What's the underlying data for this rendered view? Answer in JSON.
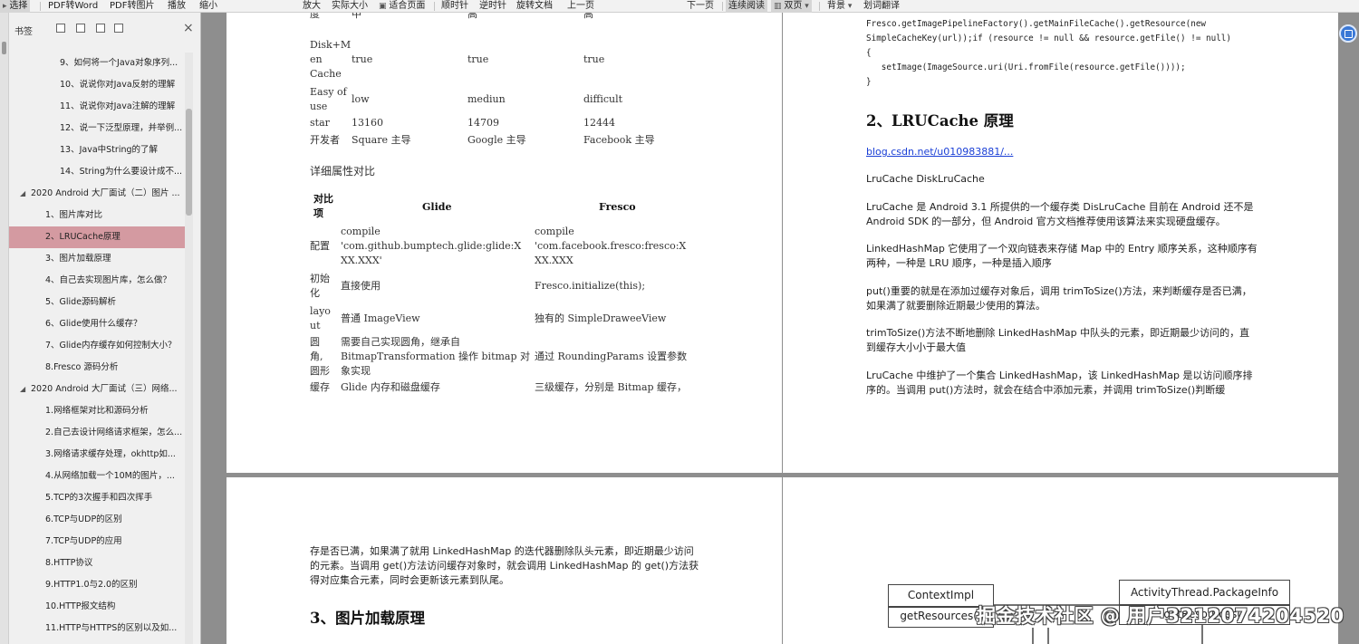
{
  "toolbar": {
    "select": "选择",
    "pdf_to_word": "PDF转Word",
    "pdf_to_image": "PDF转图片",
    "play": "播放",
    "zoom_out": "缩小",
    "zoom_in": "放大",
    "actual_size": "实际大小",
    "fit_page": "适合页面",
    "rotate_cw": "顺时针",
    "rotate_ccw": "逆时针",
    "rotate_doc": "旋转文档",
    "prev_page": "上一页",
    "next_page": "下一页",
    "continuous": "连续阅读",
    "two_page": "双页",
    "background": "背景",
    "translate": "划词翻译"
  },
  "sidebar": {
    "title": "书签",
    "bookmarks": [
      {
        "label": "9、如何将一个Java对象序列...",
        "level": 2
      },
      {
        "label": "10、说说你对Java反射的理解",
        "level": 2
      },
      {
        "label": "11、说说你对Java注解的理解",
        "level": 2
      },
      {
        "label": "12、说一下泛型原理，并举例...",
        "level": 2
      },
      {
        "label": "13、Java中String的了解",
        "level": 2
      },
      {
        "label": "14、String为什么要设计成不...",
        "level": 2
      },
      {
        "label": "2020 Android 大厂面试（二）图片 ...",
        "level": 1
      },
      {
        "label": "1、图片库对比",
        "level": 2
      },
      {
        "label": "2、LRUCache原理",
        "level": 2,
        "selected": true
      },
      {
        "label": "3、图片加载原理",
        "level": 2
      },
      {
        "label": "4、自己去实现图片库，怎么做？",
        "level": 2
      },
      {
        "label": "5、Glide源码解析",
        "level": 2
      },
      {
        "label": "6、Glide使用什么缓存？",
        "level": 2
      },
      {
        "label": "7、Glide内存缓存如何控制大小？",
        "level": 2
      },
      {
        "label": "8.Fresco 源码分析",
        "level": 2
      },
      {
        "label": "2020 Android 大厂面试（三）网络...",
        "level": 1
      },
      {
        "label": "1.网络框架对比和源码分析",
        "level": 2
      },
      {
        "label": "2.自己去设计网络请求框架，怎么...",
        "level": 2
      },
      {
        "label": "3.网络请求缓存处理，okhttp如...",
        "level": 2
      },
      {
        "label": "4.从网络加载一个10M的图片，...",
        "level": 2
      },
      {
        "label": "5.TCP的3次握手和四次挥手",
        "level": 2
      },
      {
        "label": "6.TCP与UDP的区别",
        "level": 2
      },
      {
        "label": "7.TCP与UDP的应用",
        "level": 2
      },
      {
        "label": "8.HTTP协议",
        "level": 2
      },
      {
        "label": "9.HTTP1.0与2.0的区别",
        "level": 2
      },
      {
        "label": "10.HTTP报文结构",
        "level": 2
      },
      {
        "label": "11.HTTP与HTTPS的区别以及如...",
        "level": 2
      }
    ]
  },
  "page1": {
    "top_table": {
      "r0": [
        "度",
        "中",
        "高",
        "高"
      ],
      "r1": [
        "Disk+M\nen\nCache",
        "true",
        "true",
        "true"
      ],
      "r2": [
        "Easy of\nuse",
        "low",
        "mediun",
        "difficult"
      ],
      "r3": [
        "star",
        "13160",
        "14709",
        "12444"
      ],
      "r4": [
        "开发者",
        "Square 主导",
        "Google 主导",
        "Facebook 主导"
      ]
    },
    "detail_caption": "详细属性对比",
    "detail_table": {
      "headers": [
        "对比\n项",
        "Glide",
        "Fresco"
      ],
      "rows": [
        [
          "配置",
          "compile\n'com.github.bumptech.glide:glide:X\nXX.XXX'",
          "compile\n'com.facebook.fresco:fresco:X\nXX.XXX"
        ],
        [
          "初始\n化",
          "直接使用",
          "Fresco.initialize(this);"
        ],
        [
          "layo\nut",
          "普通 ImageView",
          "独有的 SimpleDraweeView"
        ],
        [
          "圆\n角,\n圆形",
          "需要自己实现圆角，继承自\nBitmapTransformation 操作 bitmap 对\n象实现",
          "通过 RoundingParams 设置参数"
        ],
        [
          "缓存",
          "Glide 内存和磁盘缓存",
          "三级缓存，分别是 Bitmap 缓存，"
        ]
      ]
    }
  },
  "page2": {
    "code_lines": [
      "Fresco.getImagePipelineFactory().getMainFileCache().getResource(new",
      "SimpleCacheKey(url));if (resource != null && resource.getFile() != null)",
      "{",
      "   setImage(ImageSource.uri(Uri.fromFile(resource.getFile())));",
      "}"
    ],
    "heading": "2、LRUCache 原理",
    "link": "blog.csdn.net/u010983881/...",
    "p_classes": "LruCache DiskLruCache",
    "p1": "LruCache 是 Android 3.1 所提供的一个缓存类 DisLruCache 目前在 Android 还不是 Android SDK 的一部分，但 Android 官方文档推荐使用该算法来实现硬盘缓存。",
    "p2": "LinkedHashMap 它使用了一个双向链表来存储 Map 中的 Entry 顺序关系，这种顺序有两种，一种是 LRU 顺序，一种是插入顺序",
    "p3": "put()重要的就是在添加过缓存对象后，调用 trimToSize()方法，来判断缓存是否已满，如果满了就要删除近期最少使用的算法。",
    "p4": "trimToSize()方法不断地删除 LinkedHashMap 中队头的元素，即近期最少访问的，直到缓存大小小于最大值",
    "p5": "LruCache 中维护了一个集合 LinkedHashMap，该 LinkedHashMap 是以访问顺序排序的。当调用 put()方法时，就会在结合中添加元素，并调用 trimToSize()判断缓"
  },
  "page3": {
    "para": "存是否已满，如果满了就用 LinkedHashMap 的迭代器删除队头元素，即近期最少访问的元素。当调用 get()方法访问缓存对象时，就会调用 LinkedHashMap 的 get()方法获得对应集合元素，同时会更新该元素到队尾。",
    "heading": "3、图片加载原理"
  },
  "page4": {
    "box1_title": "ContextImpl",
    "box1_method": "getResources()",
    "box2_title": "ActivityThread.PackageInfo",
    "box2_method": "getResources()"
  },
  "watermark": "掘金技术社区 @ 用户3212074204520"
}
